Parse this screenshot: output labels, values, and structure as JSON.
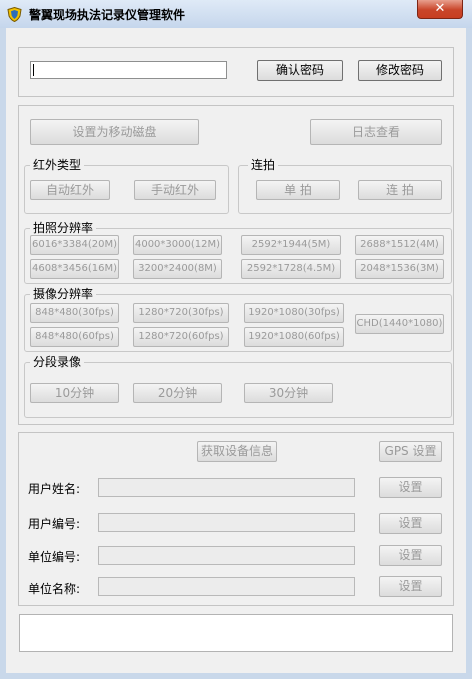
{
  "window": {
    "title": "警翼现场执法记录仪管理软件",
    "close_symbol": "✕"
  },
  "login": {
    "password_value": "",
    "confirm_label": "确认密码",
    "change_label": "修改密码"
  },
  "tools": {
    "usb_disk_label": "设置为移动磁盘",
    "log_label": "日志查看"
  },
  "infrared": {
    "title": "红外类型",
    "auto_label": "自动红外",
    "manual_label": "手动红外"
  },
  "burst": {
    "title": "连拍",
    "single_label": "单 拍",
    "continuous_label": "连 拍"
  },
  "photo_resolution": {
    "title": "拍照分辨率",
    "options": [
      "6016*3384(20M)",
      "4000*3000(12M)",
      "2592*1944(5M)",
      "2688*1512(4M)",
      "4608*3456(16M)",
      "3200*2400(8M)",
      "2592*1728(4.5M)",
      "2048*1536(3M)"
    ]
  },
  "video_resolution": {
    "title": "摄像分辨率",
    "options": [
      "848*480(30fps)",
      "1280*720(30fps)",
      "1920*1080(30fps)",
      "848*480(60fps)",
      "1280*720(60fps)",
      "1920*1080(60fps)",
      "CHD(1440*1080)"
    ]
  },
  "segment": {
    "title": "分段录像",
    "options": [
      "10分钟",
      "20分钟",
      "30分钟"
    ]
  },
  "device": {
    "get_info_label": "获取设备信息",
    "gps_label": "GPS 设置",
    "set_label": "设置",
    "fields": [
      {
        "label": "用户姓名:",
        "value": ""
      },
      {
        "label": "用户编号:",
        "value": ""
      },
      {
        "label": "单位编号:",
        "value": ""
      },
      {
        "label": "单位名称:",
        "value": ""
      }
    ]
  },
  "status": {
    "text": ""
  },
  "colors": {
    "titlebar": "#c5d6ec",
    "close_button": "#c9452a",
    "disabled_text": "#9a9a9a",
    "background": "#f0f0f0"
  }
}
